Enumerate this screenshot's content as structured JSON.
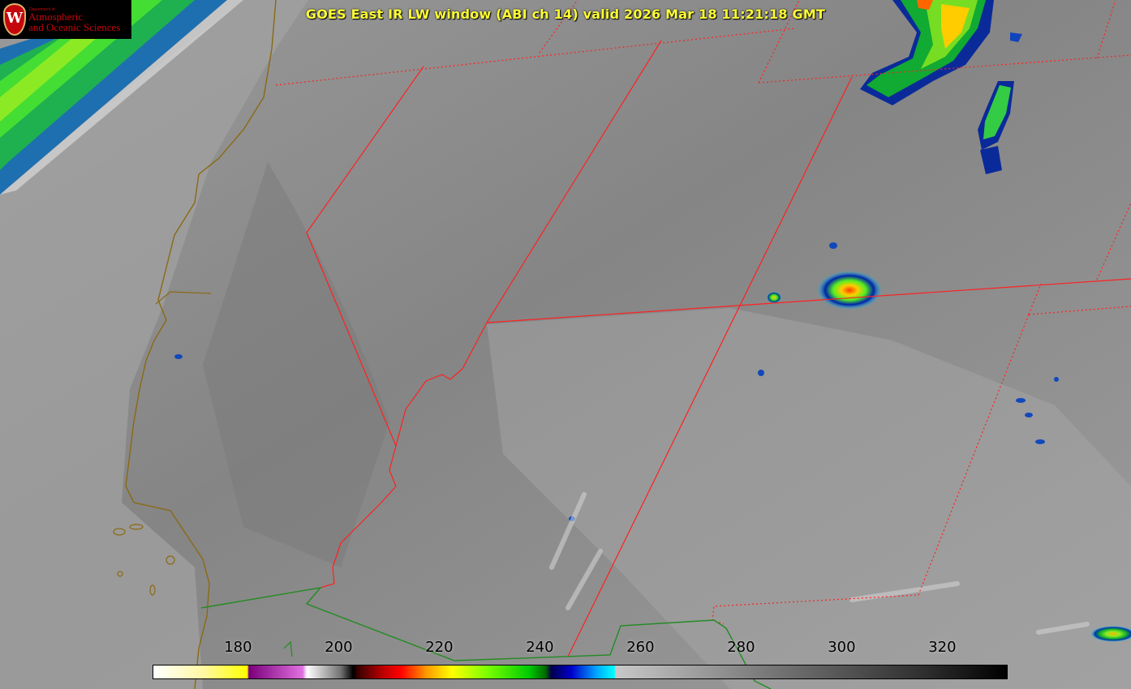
{
  "title": "GOES East IR LW window (ABI ch 14) valid 2026 Mar 18 11:21:18 GMT",
  "logo": {
    "dept_small": "Department of",
    "line1": "Atmospheric",
    "line2": "and Oceanic Sciences",
    "seal_letter": "W"
  },
  "colorbar": {
    "ticks": [
      "180",
      "200",
      "220",
      "240",
      "260",
      "280",
      "300",
      "320"
    ],
    "tick_values": [
      180,
      200,
      220,
      240,
      260,
      280,
      300,
      320
    ],
    "range": [
      163,
      333
    ]
  },
  "colors": {
    "title": "#ffff33",
    "state_borders": "#ff2020",
    "coastline": "#8b6914",
    "country_border": "#228b22"
  }
}
